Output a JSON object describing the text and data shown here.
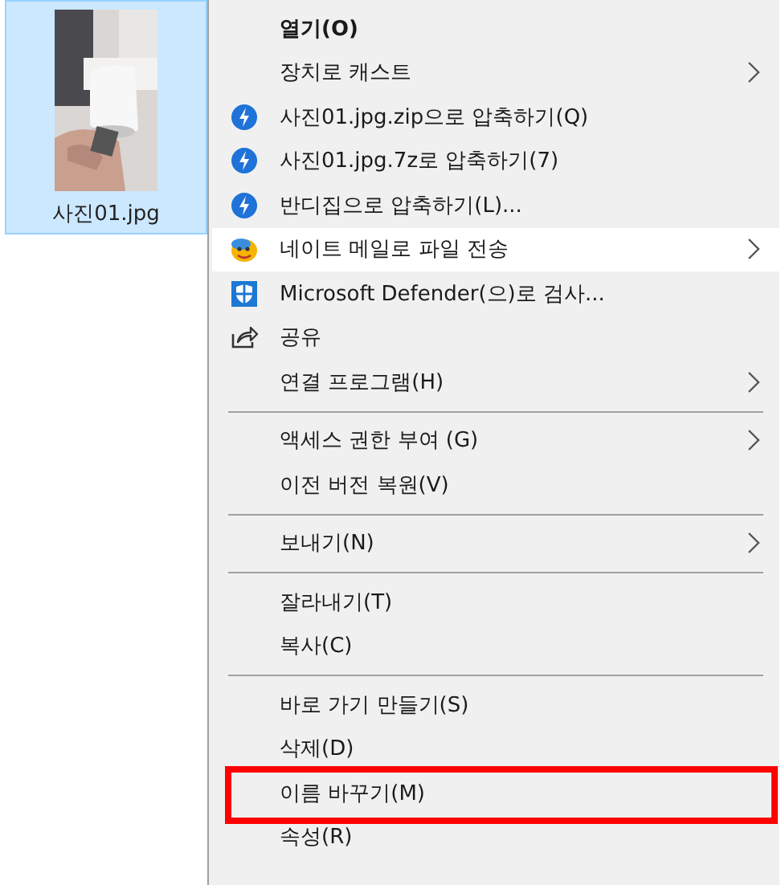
{
  "file_tile": {
    "name": "사진01.jpg",
    "selected": true
  },
  "context_menu": {
    "groups": [
      {
        "items": [
          {
            "label": "열기(O)",
            "kind": "plain",
            "submenu": false,
            "selected": false,
            "bold": true,
            "annotated": false
          },
          {
            "label": "장치로 캐스트",
            "kind": "plain",
            "submenu": true,
            "selected": false,
            "bold": false,
            "annotated": false
          },
          {
            "label": "사진01.jpg.zip으로 압축하기(Q)",
            "kind": "bandizip",
            "submenu": false,
            "selected": false,
            "bold": false,
            "annotated": false
          },
          {
            "label": "사진01.jpg.7z로 압축하기(7)",
            "kind": "bandizip",
            "submenu": false,
            "selected": false,
            "bold": false,
            "annotated": false
          },
          {
            "label": "반디집으로 압축하기(L)...",
            "kind": "bandizip",
            "submenu": false,
            "selected": false,
            "bold": false,
            "annotated": false
          },
          {
            "label": "네이트 메일로 파일 전송",
            "kind": "nate",
            "submenu": true,
            "selected": true,
            "bold": false,
            "annotated": false
          },
          {
            "label": "Microsoft Defender(으)로 검사...",
            "kind": "defender",
            "submenu": false,
            "selected": false,
            "bold": false,
            "annotated": false
          },
          {
            "label": "공유",
            "kind": "share",
            "submenu": false,
            "selected": false,
            "bold": false,
            "annotated": false
          },
          {
            "label": "연결 프로그램(H)",
            "kind": "plain",
            "submenu": true,
            "selected": false,
            "bold": false,
            "annotated": false
          }
        ]
      },
      {
        "items": [
          {
            "label": "액세스 권한 부여 (G)",
            "kind": "plain",
            "submenu": true,
            "selected": false,
            "bold": false,
            "annotated": false
          },
          {
            "label": "이전 버전 복원(V)",
            "kind": "plain",
            "submenu": false,
            "selected": false,
            "bold": false,
            "annotated": false
          }
        ]
      },
      {
        "items": [
          {
            "label": "보내기(N)",
            "kind": "plain",
            "submenu": true,
            "selected": false,
            "bold": false,
            "annotated": false
          }
        ]
      },
      {
        "items": [
          {
            "label": "잘라내기(T)",
            "kind": "plain",
            "submenu": false,
            "selected": false,
            "bold": false,
            "annotated": false
          },
          {
            "label": "복사(C)",
            "kind": "plain",
            "submenu": false,
            "selected": false,
            "bold": false,
            "annotated": false
          }
        ]
      },
      {
        "items": [
          {
            "label": "바로 가기 만들기(S)",
            "kind": "plain",
            "submenu": false,
            "selected": false,
            "bold": false,
            "annotated": false
          },
          {
            "label": "삭제(D)",
            "kind": "plain",
            "submenu": false,
            "selected": false,
            "bold": false,
            "annotated": false
          },
          {
            "label": "이름 바꾸기(M)",
            "kind": "plain",
            "submenu": false,
            "selected": false,
            "bold": false,
            "annotated": true
          },
          {
            "label": "속성(R)",
            "kind": "plain",
            "submenu": false,
            "selected": false,
            "bold": false,
            "annotated": false
          }
        ]
      }
    ]
  }
}
